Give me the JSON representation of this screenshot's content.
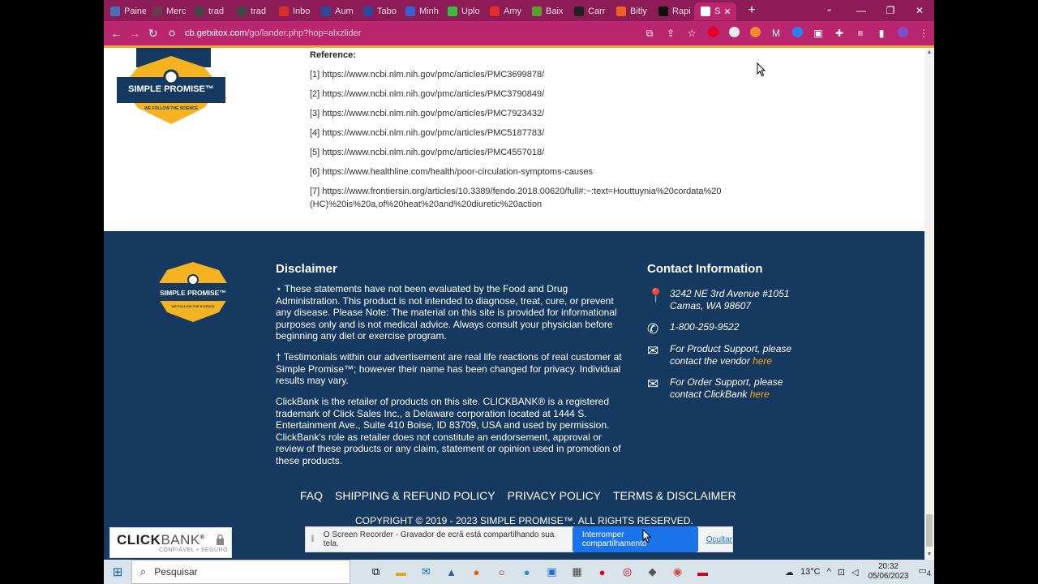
{
  "browser": {
    "tabs": [
      {
        "label": "Paine",
        "icon": "panel-icon",
        "color": "#4a6fb5"
      },
      {
        "label": "Merc",
        "icon": "market-icon",
        "color": "#6b3a4e"
      },
      {
        "label": "trad",
        "icon": "translate-icon",
        "color": "#444"
      },
      {
        "label": "trad",
        "icon": "translate-icon",
        "color": "#444"
      },
      {
        "label": "Inbo",
        "icon": "gmail-icon",
        "color": "#d93025"
      },
      {
        "label": "Aum",
        "icon": "doc-icon",
        "color": "#2c4a9a"
      },
      {
        "label": "Tabo",
        "icon": "doc-icon",
        "color": "#2c4a9a"
      },
      {
        "label": "Minh",
        "icon": "v-icon",
        "color": "#3a5fd0"
      },
      {
        "label": "Uplo",
        "icon": "upload-icon",
        "color": "#3dbb3d"
      },
      {
        "label": "Amy",
        "icon": "youtube-icon",
        "color": "#e52d27"
      },
      {
        "label": "Baix",
        "icon": "download-icon",
        "color": "#5c9e2a"
      },
      {
        "label": "Carr",
        "icon": "github-icon",
        "color": "#222"
      },
      {
        "label": "Bitly",
        "icon": "bitly-icon",
        "color": "#ee6123"
      },
      {
        "label": "Rapi",
        "icon": "r-icon",
        "color": "#111"
      },
      {
        "label": "S",
        "icon": "chrome-icon",
        "color": "#ffffff",
        "active": true
      }
    ],
    "new_tab": "+",
    "url_host": "cb.getxitox.com",
    "url_path": "/go/lander.php?hop=alxzlider"
  },
  "references": {
    "title": "Reference:",
    "items": [
      "[1] https://www.ncbi.nlm.nih.gov/pmc/articles/PMC3699878/",
      "[2] https://www.ncbi.nlm.nih.gov/pmc/articles/PMC3790849/",
      "[3] https://www.ncbi.nlm.nih.gov/pmc/articles/PMC7923432/",
      "[4] https://www.ncbi.nlm.nih.gov/pmc/articles/PMC5187783/",
      "[5] https://www.ncbi.nlm.nih.gov/pmc/articles/PMC4557018/",
      "[6] https://www.healthline.com/health/poor-circulation-symptoms-causes",
      "[7] https://www.frontiersin.org/articles/10.3389/fendo.2018.00620/full#:~:text=Houttuynia%20cordata%20",
      "(HC)%20is%20a,of%20heat%20and%20diuretic%20action"
    ]
  },
  "logo": {
    "name": "SIMPLE PROMISE",
    "tm": "™",
    "tagline": "WE FOLLOW THE SCIENCE"
  },
  "footer": {
    "disclaimer_title": "Disclaimer",
    "disclaimer_p1": "⋆ These statements have not been evaluated by the Food and Drug Administration. This product is not intended to diagnose, treat, cure, or prevent any disease. Please Note: The material on this site is provided for informational purposes only and is not medical advice. Always consult your physician before beginning any diet or exercise program.",
    "disclaimer_p2": "† Testimonials within our advertisement are real life reactions of real customer at Simple Promise™; however their name has been changed for privacy. Individual results may vary.",
    "disclaimer_p3": "ClickBank is the retailer of products on this site. CLICKBANK® is a registered trademark of Click Sales Inc., a Delaware corporation located at 1444 S. Entertainment Ave., Suite 410 Boise, ID 83709, USA and used by permission. ClickBank's role as retailer does not constitute an endorsement, approval or review of these products or any claim, statement or opinion used in promotion of these products.",
    "contact_title": "Contact Information",
    "address_line1": "3242 NE 3rd Avenue #1051",
    "address_line2": "Camas, WA 98607",
    "phone": "1-800-259-9522",
    "product_support": "For Product Support, please contact the vendor ",
    "product_support_link": "here",
    "order_support": "For Order Support, please contact ClickBank ",
    "order_support_link": "here",
    "nav": [
      "FAQ",
      "SHIPPING & REFUND POLICY",
      "PRIVACY POLICY",
      "TERMS & DISCLAIMER"
    ],
    "copyright": "COPYRIGHT © 2019 - 2023 SIMPLE PROMISE™. ALL RIGHTS RESERVED."
  },
  "share_bar": {
    "message": "O Screen Recorder - Gravador de ecrã está compartilhando sua tela.",
    "stop_label": "Interromper compartilhamento",
    "hide_label": "Ocultar"
  },
  "clickbank_badge": {
    "brand_bold": "CLICK",
    "brand_light": "BANK",
    "registered": "®",
    "sub": "CONFIÁVEL • SEGURO"
  },
  "taskbar": {
    "search_placeholder": "Pesquisar",
    "temperature": "13°C",
    "time": "20:32",
    "date": "05/06/2023",
    "notification_count": "4"
  },
  "colors": {
    "tab_strip": "#8c1b57",
    "toolbar": "#b9266f",
    "footer_bg": "#163a5f",
    "accent": "#f5a623"
  }
}
